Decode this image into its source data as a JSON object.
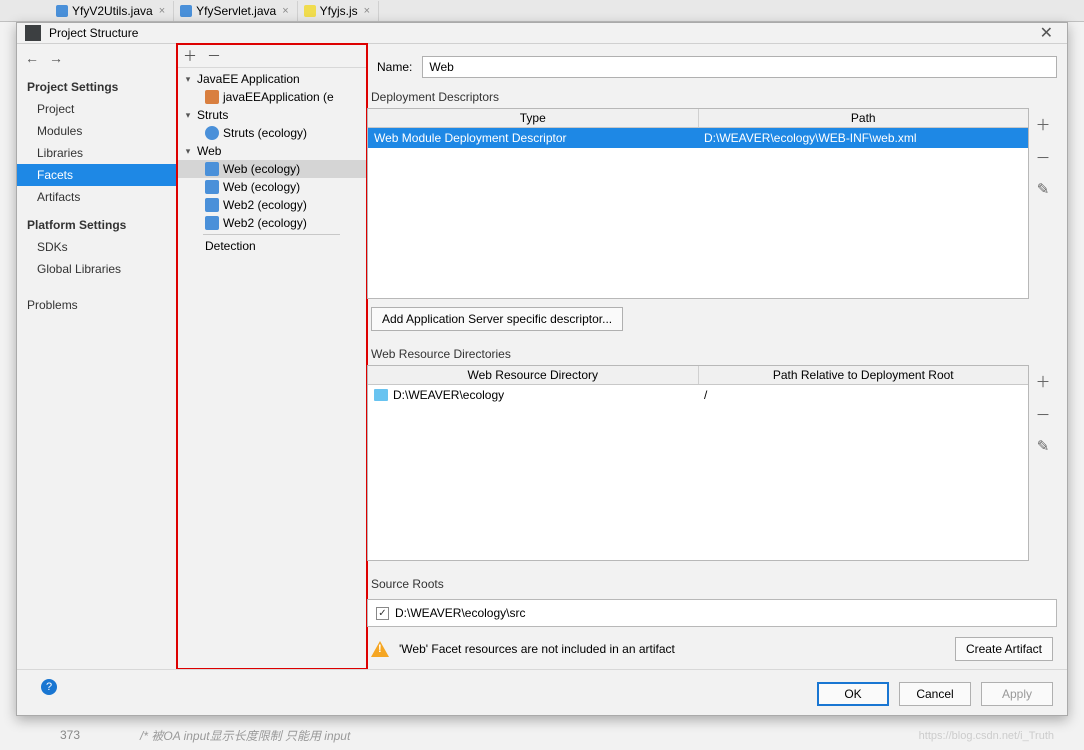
{
  "tabs": [
    {
      "name": "YfyV2Utils.java"
    },
    {
      "name": "YfyServlet.java"
    },
    {
      "name": "Yfyjs.js"
    }
  ],
  "dialog": {
    "title": "Project Structure",
    "sections": {
      "projectSettings": {
        "header": "Project Settings",
        "items": [
          "Project",
          "Modules",
          "Libraries",
          "Facets",
          "Artifacts"
        ]
      },
      "platformSettings": {
        "header": "Platform Settings",
        "items": [
          "SDKs",
          "Global Libraries"
        ]
      },
      "problems": "Problems"
    },
    "tree": {
      "javaee": {
        "label": "JavaEE Application",
        "child": "javaEEApplication (e"
      },
      "struts": {
        "label": "Struts",
        "child": "Struts (ecology)"
      },
      "web": {
        "label": "Web",
        "children": [
          "Web (ecology)",
          "Web (ecology)",
          "Web2 (ecology)",
          "Web2 (ecology)"
        ]
      },
      "detection": "Detection"
    },
    "form": {
      "nameLabel": "Name:",
      "nameValue": "Web",
      "deploymentDescriptors": {
        "label": "Deployment Descriptors",
        "headers": [
          "Type",
          "Path"
        ],
        "row": {
          "type": "Web Module Deployment Descriptor",
          "path": "D:\\WEAVER\\ecology\\WEB-INF\\web.xml"
        }
      },
      "addServerBtn": "Add Application Server specific descriptor...",
      "webResourceDirs": {
        "label": "Web Resource Directories",
        "headers": [
          "Web Resource Directory",
          "Path Relative to Deployment Root"
        ],
        "row": {
          "dir": "D:\\WEAVER\\ecology",
          "rel": "/"
        }
      },
      "sourceRoots": {
        "label": "Source Roots",
        "item": "D:\\WEAVER\\ecology\\src"
      },
      "warning": "'Web' Facet resources are not included in an artifact",
      "createArtifact": "Create Artifact"
    },
    "buttons": {
      "ok": "OK",
      "cancel": "Cancel",
      "apply": "Apply"
    }
  },
  "bottom": {
    "lineNumber": "373",
    "comment": "/* 被OA input显示长度限制   只能用 input",
    "watermark": "https://blog.csdn.net/i_Truth"
  }
}
